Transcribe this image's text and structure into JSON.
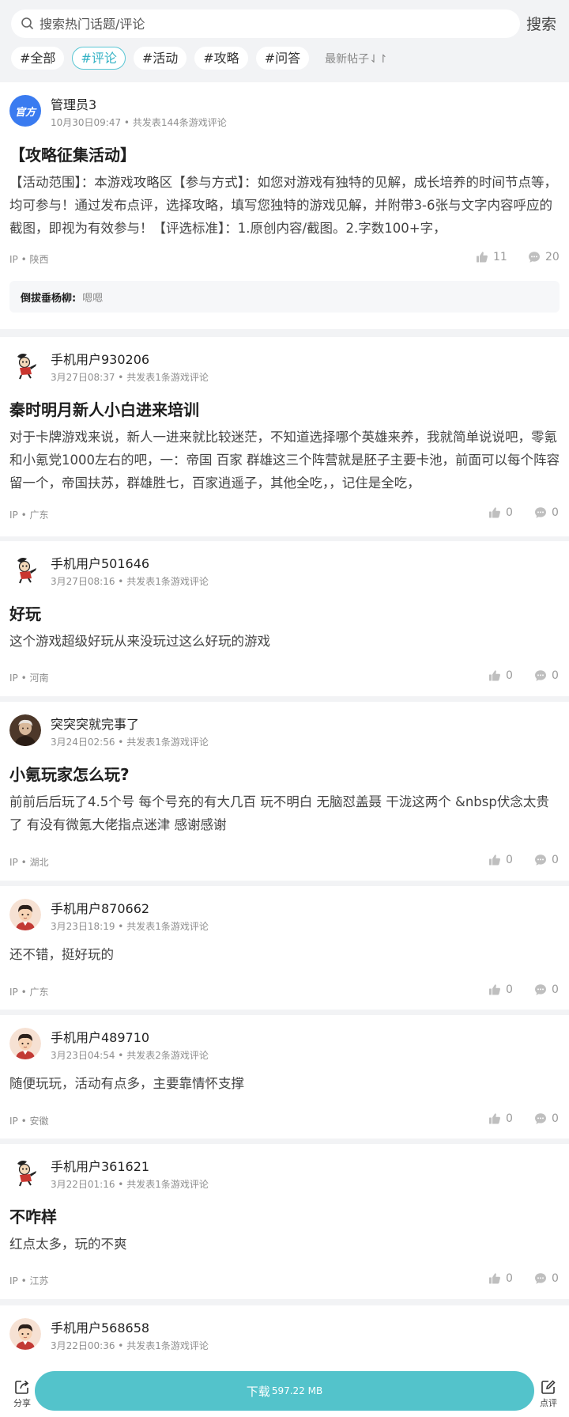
{
  "search": {
    "placeholder": "搜索热门话题/评论",
    "button_label": "搜索"
  },
  "tabs": [
    {
      "label": "#全部",
      "active": false
    },
    {
      "label": "#评论",
      "active": true
    },
    {
      "label": "#活动",
      "active": false
    },
    {
      "label": "#攻略",
      "active": false
    },
    {
      "label": "#问答",
      "active": false
    }
  ],
  "sort_label": "最新帖子⇃↾",
  "posts": [
    {
      "user": "管理员3",
      "avatar_text": "官方",
      "meta": "10月30日09:47 • 共发表144条游戏评论",
      "title": "【攻略征集活动】",
      "body": "【活动范围】：本游戏攻略区【参与方式】：如您对游戏有独特的见解，成长培养的时间节点等，均可参与！通过发布点评，选择攻略，填写您独特的游戏见解，并附带3-6张与文字内容呼应的截图，即视为有效参与！【评选标准】：1.原创内容/截图。2.字数100+字，",
      "ip": "IP • 陕西",
      "likes": "11",
      "comments": "20",
      "reply": {
        "name": "倒拔垂杨柳:",
        "text": "嗯嗯"
      }
    },
    {
      "user": "手机用户930206",
      "meta": "3月27日08:37 • 共发表1条游戏评论",
      "title": "秦时明月新人小白进来培训",
      "body": "对于卡牌游戏来说，新人一进来就比较迷茫，不知道选择哪个英雄来养，我就简单说说吧，零氪和小氪党1000左右的吧，一：帝国 百家 群雄这三个阵营就是胚子主要卡池，前面可以每个阵容留一个，帝国扶苏，群雄胜七，百家逍遥子，其他全吃，，记住是全吃，",
      "ip": "IP • 广东",
      "likes": "0",
      "comments": "0"
    },
    {
      "user": "手机用户501646",
      "meta": "3月27日08:16 • 共发表1条游戏评论",
      "title": "好玩",
      "body": "这个游戏超级好玩从来没玩过这么好玩的游戏",
      "ip": "IP • 河南",
      "likes": "0",
      "comments": "0"
    },
    {
      "user": "突突突就完事了",
      "meta": "3月24日02:56 • 共发表1条游戏评论",
      "title": "小氪玩家怎么玩?",
      "body": "前前后后玩了4.5个号 每个号充的有大几百 玩不明白 无脑怼盖聂 干泷这两个 &nbsp伏念太贵了 有没有微氪大佬指点迷津 感谢感谢",
      "ip": "IP • 湖北",
      "likes": "0",
      "comments": "0"
    },
    {
      "user": "手机用户870662",
      "meta": "3月23日18:19 • 共发表1条游戏评论",
      "body": "还不错，挺好玩的",
      "ip": "IP • 广东",
      "likes": "0",
      "comments": "0"
    },
    {
      "user": "手机用户489710",
      "meta": "3月23日04:54 • 共发表2条游戏评论",
      "body": "随便玩玩，活动有点多，主要靠情怀支撑",
      "ip": "IP • 安徽",
      "likes": "0",
      "comments": "0"
    },
    {
      "user": "手机用户361621",
      "meta": "3月22日01:16 • 共发表1条游戏评论",
      "title": "不咋样",
      "body": "红点太多，玩的不爽",
      "ip": "IP • 江苏",
      "likes": "0",
      "comments": "0"
    },
    {
      "user": "手机用户568658",
      "meta": "3月22日00:36 • 共发表1条游戏评论"
    }
  ],
  "bottom": {
    "share_label": "分享",
    "download_label": "下载",
    "download_size": "597.22 MB",
    "review_label": "点评"
  },
  "colors": {
    "accent": "#53c3cb",
    "official_badge": "#3a7bf0"
  }
}
